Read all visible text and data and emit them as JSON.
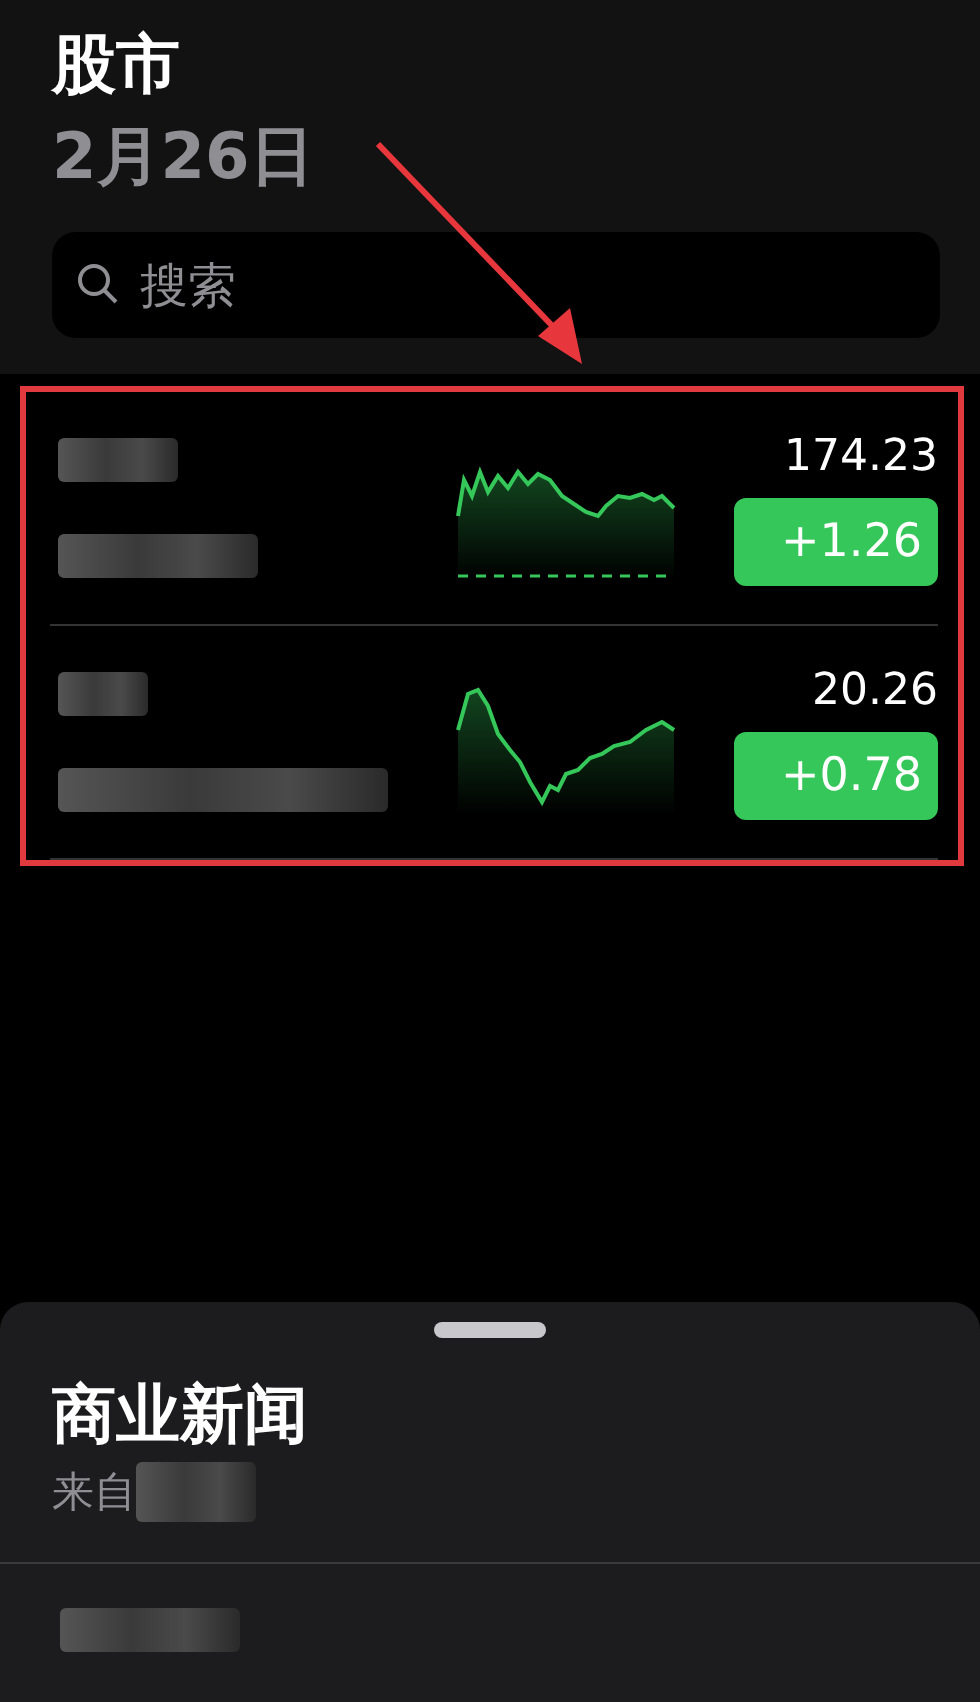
{
  "header": {
    "title": "股市",
    "date": "2月26日"
  },
  "search": {
    "placeholder": "搜索"
  },
  "stocks": [
    {
      "price": "174.23",
      "change": "+1.26",
      "kind": "up",
      "previous_close_line": true
    },
    {
      "price": "20.26",
      "change": "+0.78",
      "kind": "up",
      "previous_close_line": false
    }
  ],
  "news": {
    "title": "商业新闻",
    "source": "来自"
  }
}
